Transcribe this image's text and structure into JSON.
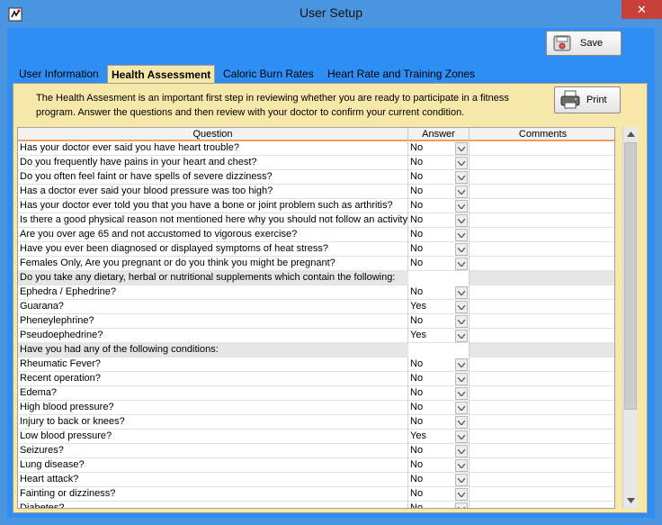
{
  "window": {
    "title": "User Setup",
    "close_label": "✕"
  },
  "toolbar": {
    "save_label": "Save"
  },
  "tabs": [
    {
      "label": "User Information"
    },
    {
      "label": "Health Assessment"
    },
    {
      "label": "Caloric Burn Rates"
    },
    {
      "label": "Heart Rate and Training Zones"
    }
  ],
  "panel": {
    "intro_line1": "The Health Assesment is an important first step in reviewing whether you are ready to participate in a fitness",
    "intro_line2": "program.  Answer the questions and then review with your doctor to confirm your current condition.",
    "print_label": "Print"
  },
  "grid": {
    "headers": {
      "question": "Question",
      "answer": "Answer",
      "comments": "Comments"
    },
    "rows": [
      {
        "q": "Has your doctor ever said you have heart trouble?",
        "a": "No"
      },
      {
        "q": "Do you frequently have pains in your heart and chest?",
        "a": "No"
      },
      {
        "q": "Do you often feel faint or have spells of severe dizziness?",
        "a": "No"
      },
      {
        "q": "Has a doctor ever said your blood pressure was too high?",
        "a": "No"
      },
      {
        "q": "Has your doctor ever told you that you have a bone or joint problem such as arthritis?",
        "a": "No"
      },
      {
        "q": "Is there a good physical reason not mentioned here why you should not follow an activity",
        "a": "No"
      },
      {
        "q": "Are you over age 65 and not accustomed to vigorous exercise?",
        "a": "No"
      },
      {
        "q": "Have you ever been diagnosed or displayed symptoms of heat stress?",
        "a": "No"
      },
      {
        "q": "Females Only, Are you pregnant or do you think you might be pregnant?",
        "a": "No"
      },
      {
        "q": "Do you take any dietary, herbal or nutritional supplements which contain the following:",
        "a": ""
      },
      {
        "q": "Ephedra / Ephedrine?",
        "a": "No"
      },
      {
        "q": "Guarana?",
        "a": "Yes"
      },
      {
        "q": "Pheneylephrine?",
        "a": "No"
      },
      {
        "q": "Pseudoephedrine?",
        "a": "Yes"
      },
      {
        "q": "Have you had any of the following conditions:",
        "a": ""
      },
      {
        "q": "Rheumatic Fever?",
        "a": "No"
      },
      {
        "q": "Recent operation?",
        "a": "No"
      },
      {
        "q": "Edema?",
        "a": "No"
      },
      {
        "q": "High blood pressure?",
        "a": "No"
      },
      {
        "q": "Injury to back or knees?",
        "a": "No"
      },
      {
        "q": "Low blood pressure?",
        "a": "Yes"
      },
      {
        "q": "Seizures?",
        "a": "No"
      },
      {
        "q": "Lung disease?",
        "a": "No"
      },
      {
        "q": "Heart attack?",
        "a": "No"
      },
      {
        "q": "Fainting or dizziness?",
        "a": "No"
      },
      {
        "q": "Diabetes?",
        "a": "No"
      }
    ]
  }
}
